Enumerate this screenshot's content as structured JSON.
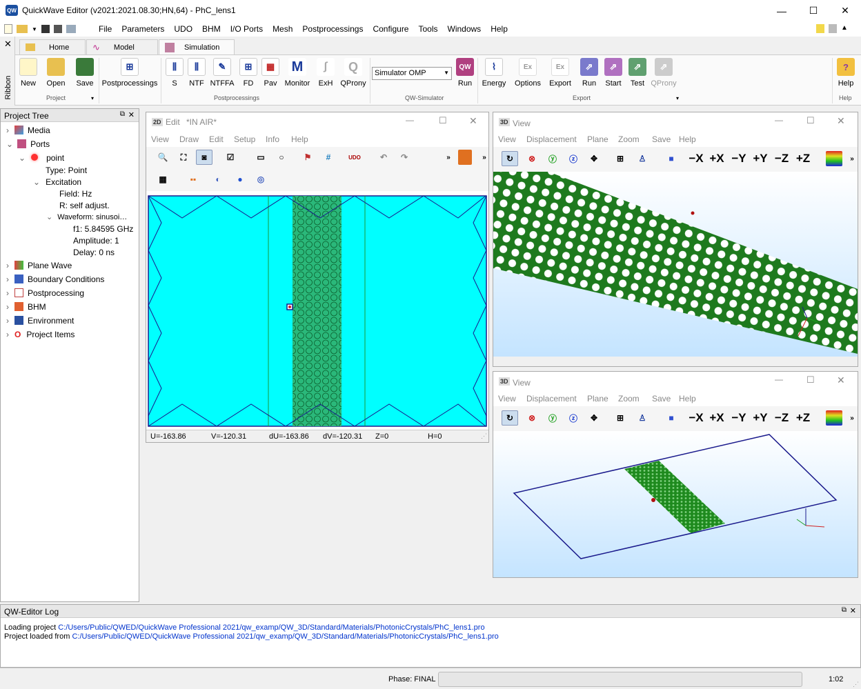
{
  "window": {
    "title": "QuickWave Editor (v2021:2021.08.30;HN,64) - PhC_lens1"
  },
  "menubar": {
    "items": [
      "File",
      "Parameters",
      "UDO",
      "BHM",
      "I/O Ports",
      "Mesh",
      "Postprocessings",
      "Configure",
      "Tools",
      "Windows",
      "Help"
    ]
  },
  "ribbon": {
    "side_label": "Ribbon",
    "tabs": [
      "Home",
      "Model",
      "Simulation"
    ],
    "buttons": {
      "new": "New",
      "open": "Open",
      "save": "Save",
      "postprocessings": "Postprocessings",
      "s": "S",
      "ntf": "NTF",
      "ntffa": "NTFFA",
      "fd": "FD",
      "pav": "Pav",
      "monitor": "Monitor",
      "exh": "ExH",
      "qprony": "QProny",
      "run": "Run",
      "energy": "Energy",
      "options": "Options",
      "export": "Export",
      "run2": "Run",
      "start": "Start",
      "test": "Test",
      "qprony2": "QProny",
      "help": "Help"
    },
    "groups": {
      "project": "Project",
      "postprocessings": "Postprocessings",
      "simulator": "QW-Simulator",
      "export": "Export",
      "help": "Help"
    },
    "simulator_select": "Simulator OMP"
  },
  "project_tree": {
    "title": "Project Tree",
    "media": "Media",
    "ports": "Ports",
    "point": "point",
    "type": "Type: Point",
    "excitation": "Excitation",
    "field": "Field: Hz",
    "r": "R: self adjust.",
    "waveform": "Waveform: sinusoi…",
    "f1": "f1: 5.84595 GHz",
    "amplitude": "Amplitude: 1",
    "delay": "Delay: 0 ns",
    "plane_wave": "Plane Wave",
    "boundary": "Boundary Conditions",
    "postprocessing": "Postprocessing",
    "bhm": "BHM",
    "environment": "Environment",
    "project_items": "Project Items"
  },
  "edit_window": {
    "title": "Edit",
    "subtitle": "*IN AIR*",
    "menu": [
      "View",
      "Draw",
      "Edit",
      "Setup",
      "Info",
      "Help"
    ],
    "status": {
      "u": "U=-163.86",
      "v": "V=-120.31",
      "du": "dU=-163.86",
      "dv": "dV=-120.31",
      "z": "Z=0",
      "h": "H=0"
    }
  },
  "view_window_1": {
    "title": "View",
    "menu": [
      "View",
      "Displacement",
      "Plane",
      "Zoom",
      "Save",
      "Help"
    ]
  },
  "view_window_2": {
    "title": "View",
    "menu": [
      "View",
      "Displacement",
      "Plane",
      "Zoom",
      "Save",
      "Help"
    ]
  },
  "view_toolbar": {
    "mx": "−X",
    "px": "+X",
    "my": "−Y",
    "py": "+Y",
    "mz": "−Z",
    "pz": "+Z"
  },
  "log": {
    "title": "QW-Editor Log",
    "line1_prefix": "Loading project ",
    "line1_path": "C:/Users/Public/QWED/QuickWave Professional 2021/qw_examp/QW_3D/Standard/Materials/PhotonicCrystals/PhC_lens1.pro",
    "line2_prefix": "Project loaded from ",
    "line2_path": "C:/Users/Public/QWED/QuickWave Professional 2021/qw_examp/QW_3D/Standard/Materials/PhotonicCrystals/PhC_lens1.pro"
  },
  "status": {
    "phase": "Phase: FINAL",
    "time": "1:02"
  },
  "colors": {
    "cyan": "#00ffff",
    "green": "#1a7a1a",
    "navy": "#1a1a8c"
  }
}
